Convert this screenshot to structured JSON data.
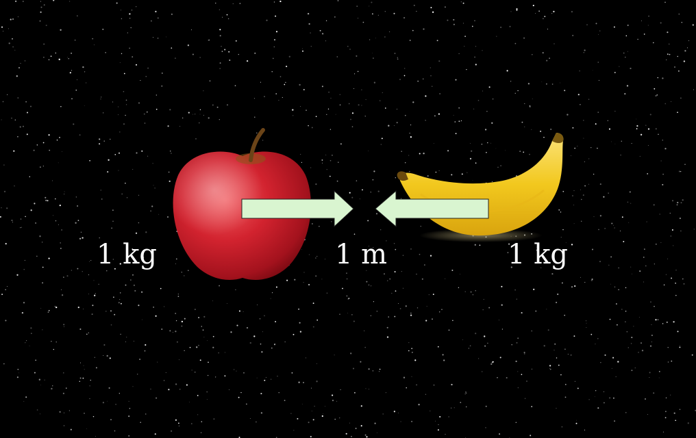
{
  "labels": {
    "apple_mass": "1 kg",
    "distance": "1 m",
    "banana_mass": "1 kg"
  },
  "objects": {
    "left": "apple",
    "right": "banana"
  },
  "colors": {
    "background": "#000000",
    "stars": "#ffffff",
    "arrow_fill": "#d9f5d0",
    "arrow_stroke": "#222222",
    "apple": "#c81e2a",
    "banana": "#f2c81e",
    "text": "#ffffff"
  }
}
